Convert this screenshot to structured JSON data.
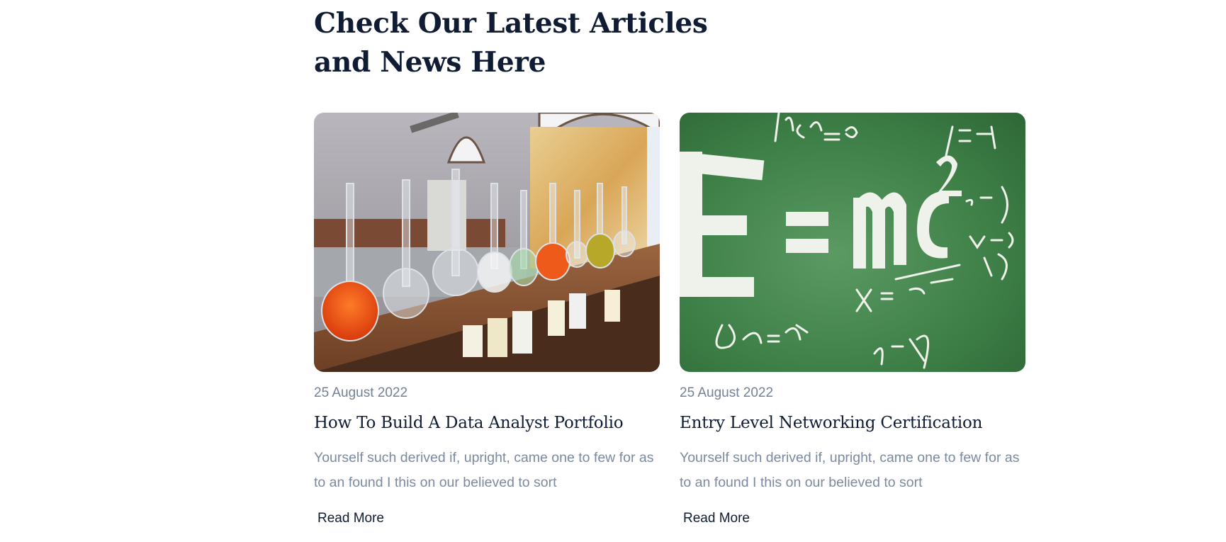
{
  "section": {
    "heading": "Check Our Latest Articles and News Here"
  },
  "articles": [
    {
      "image_icon": "lab-flasks-photo",
      "date": "25 August 2022",
      "title": "How To Build A Data Analyst Portfolio",
      "excerpt": "Yourself such derived if, upright, came one to few for as to an found I this on our believed to sort",
      "read_more": "Read More"
    },
    {
      "image_icon": "chalkboard-equations-photo",
      "date": "25 August 2022",
      "title": "Entry Level Networking Certification",
      "excerpt": "Yourself such derived if, upright, came one to few for as to an found I this on our believed to sort",
      "read_more": "Read More"
    }
  ],
  "colors": {
    "heading": "#101c33",
    "meta": "#738196",
    "body": "#7b8aa1"
  }
}
